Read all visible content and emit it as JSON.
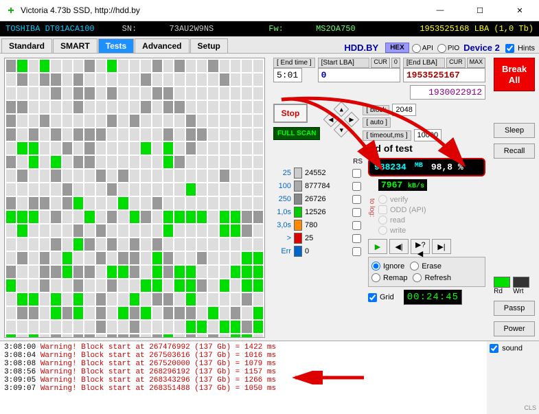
{
  "window": {
    "title": "Victoria 4.73b SSD, http://hdd.by"
  },
  "info": {
    "model": "TOSHIBA DT01ACA100",
    "sn_label": "SN:",
    "sn": "73AU2W9NS",
    "fw_label": "Fw:",
    "fw": "MS2OA750",
    "lba": "1953525168 LBA (1,0 Tb)"
  },
  "tabs": [
    "Standard",
    "SMART",
    "Tests",
    "Advanced",
    "Setup"
  ],
  "header": {
    "site": "HDD.BY",
    "hex": "HEX",
    "api": "API",
    "pio": "PIO",
    "device": "Device 2",
    "hints": "Hints"
  },
  "scan": {
    "endtime_lbl": "[ End time ]",
    "endtime": "5:01",
    "startlba_lbl": "[Start LBA]",
    "cur": "CUR",
    "zero": "0",
    "start": "0",
    "endlba_lbl": "[End LBA]",
    "max": "MAX",
    "end": "1953525167",
    "pos": "1930022912",
    "block_lbl": "[ block",
    "auto_lbl": "[ auto ]",
    "block": "2048",
    "timeout_lbl": "[ timeout,ms ]",
    "timeout": "10000",
    "stop": "Stop",
    "fullscan": "FULL SCAN",
    "eot": "End of test",
    "mb_val": "988234",
    "mb_unit": "MB",
    "pct_val": "98,8",
    "pct_unit": "%",
    "rs": "RS",
    "tolog": "to log:",
    "speed_val": "7967",
    "speed_unit": "kB/s",
    "verify": "verify",
    "odd": "ODD (API)",
    "read": "read",
    "write": "write"
  },
  "timings": [
    {
      "t": "25",
      "c": "#ccc",
      "v": "24552"
    },
    {
      "t": "100",
      "c": "#aaa",
      "v": "877784"
    },
    {
      "t": "250",
      "c": "#888",
      "v": "26726"
    },
    {
      "t": "1,0s",
      "c": "#0c0",
      "v": "12526"
    },
    {
      "t": "3,0s",
      "c": "#f80",
      "v": "780"
    },
    {
      "t": ">",
      "c": "#d00",
      "v": "25"
    },
    {
      "t": "Err",
      "c": "#06c",
      "v": "0"
    }
  ],
  "opts": {
    "ignore": "Ignore",
    "erase": "Erase",
    "remap": "Remap",
    "refresh": "Refresh",
    "grid": "Grid",
    "timer": "00:24:45"
  },
  "side": {
    "break": "Break\nAll",
    "sleep": "Sleep",
    "recall": "Recall",
    "rd": "Rd",
    "wrt": "Wrt",
    "passp": "Passp",
    "power": "Power",
    "sound": "sound",
    "cls": "CLS"
  },
  "log": [
    {
      "t": "3:08:00",
      "m": "Warning! Block start at 267476992 (137 Gb)  = 1422 ms"
    },
    {
      "t": "3:08:04",
      "m": "Warning! Block start at 267503616 (137 Gb)  = 1016 ms"
    },
    {
      "t": "3:08:08",
      "m": "Warning! Block start at 267520000 (137 Gb)  = 1079 ms"
    },
    {
      "t": "3:08:56",
      "m": "Warning! Block start at 268296192 (137 Gb)  = 1157 ms"
    },
    {
      "t": "3:09:05",
      "m": "Warning! Block start at 268343296 (137 Gb)  = 1266 ms"
    },
    {
      "t": "3:09:07",
      "m": "Warning! Block start at 268351488 (137 Gb)  = 1050 ms"
    }
  ],
  "gridmap": "dg.g...d.g...d.d..d....|.d.dd.d.....d......d...|....d.dd.d...dd........|dd....d.....d.dd.......|d..d.....d.d....d......|d.d.d.ddd.....d.dd.....|.gg..d.d....g.g.d......|d.g.g.dd......gd.......|.d..d...d.d........d...|.....d...d......g......|d.dd.dg...g..d.........|ggg.d..g.d.gd.gggg.ggdd|.g....d.d.....g....ggd.|....d.gd.d.d.d.........|.d.d.g..d.dd.gd..d...gg|d..ddgdd.ggd.gdgg...ggg|g..d..d..d..gg.ggd.g.gg|.gg.g.g.d..g.dd.g....d.|.dd.gdg.d.gdg.ddd.g.d.g|........d..d....gg.ggdg|g.g.d.dd.ddd.dg.d.d.gg.|....d..dd...d...d....d."
}
